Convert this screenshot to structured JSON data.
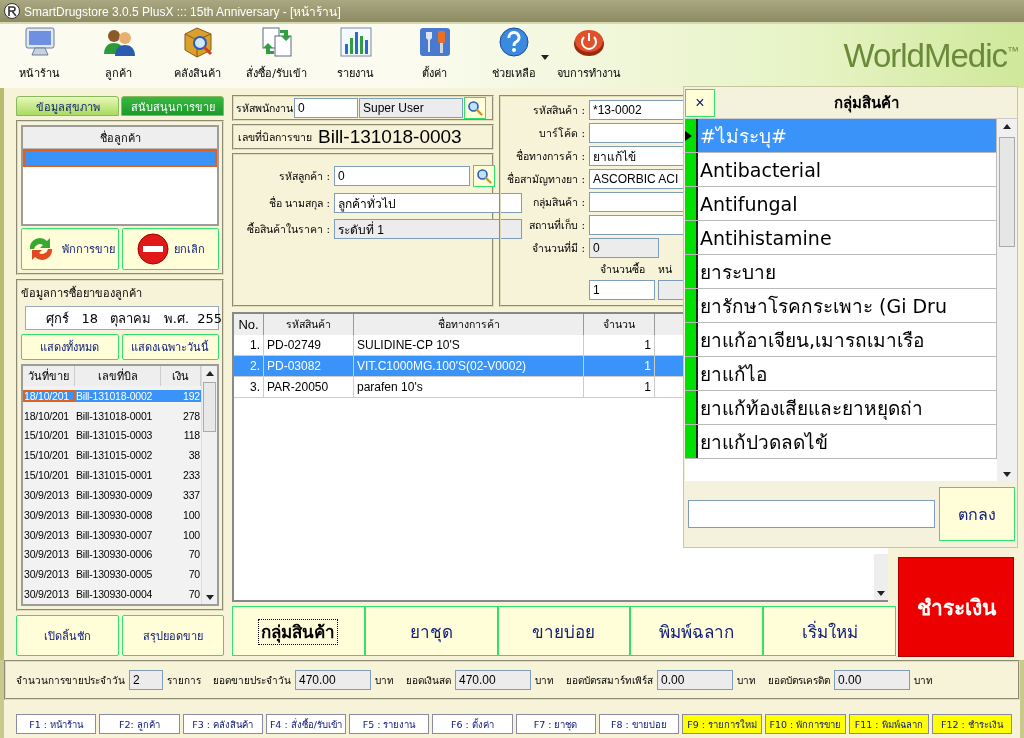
{
  "window": {
    "title": "SmartDrugstore 3.0.5 PlusX ::: 15th Anniversary - [หน้าร้าน]"
  },
  "toolbar": [
    {
      "label": "หน้าร้าน",
      "kind": "monitor",
      "has_menu": false
    },
    {
      "label": "ลูกค้า",
      "kind": "people",
      "has_menu": false
    },
    {
      "label": "คลังสินค้า",
      "kind": "stock",
      "has_menu": false
    },
    {
      "label": "สั่งซื้อ/รับเข้า",
      "kind": "exchange",
      "has_menu": false
    },
    {
      "label": "รายงาน",
      "kind": "chart",
      "has_menu": false
    },
    {
      "label": "ตั้งค่า",
      "kind": "tools",
      "has_menu": false
    },
    {
      "label": "ช่วยเหลือ",
      "kind": "help",
      "has_menu": true
    },
    {
      "label": "จบการทำงาน",
      "kind": "power",
      "has_menu": false
    }
  ],
  "logo": {
    "text": "WorldMedic",
    "mark": "™"
  },
  "left_tabs": [
    {
      "label": "ข้อมูลสุขภาพ",
      "selected": true
    },
    {
      "label": "สนับสนุนการขาย",
      "selected": false
    }
  ],
  "customer_list": {
    "header": "ชื่อลูกค้า",
    "rows": [
      {
        "selected": true
      }
    ]
  },
  "customer_buttons": [
    {
      "label": "พักการขาย",
      "kind": "hold"
    },
    {
      "label": "ยกเลิก",
      "kind": "cancel"
    }
  ],
  "history": {
    "title": "ข้อมูลการซื้อยาของลูกค้า",
    "date": {
      "day": "ศุกร์",
      "date": "18",
      "month": "ตุลาคม",
      "era": "พ.ศ.",
      "year": "255"
    },
    "buttons": [
      "แสดงทั้งหมด",
      "แสดงเฉพาะวันนี้"
    ],
    "columns": [
      "วันที่ขาย",
      "เลขที่บิล",
      "เงิน"
    ],
    "rows": [
      {
        "date": "18/10/201",
        "bill": "Bill-131018-0002",
        "amount": "192",
        "selected": true
      },
      {
        "date": "18/10/201",
        "bill": "Bill-131018-0001",
        "amount": "278",
        "selected": false
      },
      {
        "date": "15/10/201",
        "bill": "Bill-131015-0003",
        "amount": "118",
        "selected": false
      },
      {
        "date": "15/10/201",
        "bill": "Bill-131015-0002",
        "amount": "38",
        "selected": false
      },
      {
        "date": "15/10/201",
        "bill": "Bill-131015-0001",
        "amount": "233",
        "selected": false
      },
      {
        "date": "30/9/2013",
        "bill": "Bill-130930-0009",
        "amount": "337",
        "selected": false
      },
      {
        "date": "30/9/2013",
        "bill": "Bill-130930-0008",
        "amount": "100",
        "selected": false
      },
      {
        "date": "30/9/2013",
        "bill": "Bill-130930-0007",
        "amount": "100",
        "selected": false
      },
      {
        "date": "30/9/2013",
        "bill": "Bill-130930-0006",
        "amount": "70",
        "selected": false
      },
      {
        "date": "30/9/2013",
        "bill": "Bill-130930-0005",
        "amount": "70",
        "selected": false
      },
      {
        "date": "30/9/2013",
        "bill": "Bill-130930-0004",
        "amount": "70",
        "selected": false
      }
    ]
  },
  "left_bottom_buttons": [
    "เปิดลิ้นชัก",
    "สรุปยอดขาย"
  ],
  "employee": {
    "label": "รหัสพนักงาน",
    "code": "0",
    "name": "Super User"
  },
  "bill": {
    "label": "เลขที่บิลการขาย",
    "number": "Bill-131018-0003"
  },
  "customer": {
    "code_label": "รหัสลูกค้า :",
    "code": "0",
    "name_label": "ชื่อ นามสกุล :",
    "name": "ลูกค้าทั่วไป",
    "price_label": "ซื้อสินค้าในราคา :",
    "price": "ระดับที่ 1"
  },
  "product": {
    "fields": [
      {
        "label": "รหัสสินค้า :",
        "value": "*13-0002",
        "disabled": false
      },
      {
        "label": "บาร์โค้ด :",
        "disabled": false
      },
      {
        "label": "ชื่อทางการค้า :",
        "value": "ยาแก้ไข้",
        "disabled": false
      },
      {
        "label": "ชื่อสามัญทางยา :",
        "value": "ASCORBIC ACI",
        "disabled": false
      },
      {
        "label": "กลุ่มสินค้า :",
        "disabled": false
      },
      {
        "label": "สถานที่เก็บ :",
        "disabled": false
      },
      {
        "label": "จำนวนที่มี :",
        "value": "0",
        "disabled": true
      }
    ],
    "qty_label": "จำนวนซื้อ",
    "qty": "1",
    "unit_label": "หน่"
  },
  "items": {
    "columns": [
      "No.",
      "รหัสสินค้า",
      "ชื่อทางการค้า",
      "จำนวน"
    ],
    "rows": [
      {
        "no": "1.",
        "code": "PD-02749",
        "name": "SULIDINE-CP 10'S",
        "qty": "1",
        "selected": false
      },
      {
        "no": "2.",
        "code": "PD-03082",
        "name": "VIT.C1000MG.100'S(02-V0002)",
        "qty": "1",
        "selected": true
      },
      {
        "no": "3.",
        "code": "PAR-20050",
        "name": "parafen 10's",
        "qty": "1",
        "selected": false
      }
    ]
  },
  "action_buttons": [
    {
      "label": "กลุ่มสินค้า",
      "focused": true
    },
    {
      "label": "ยาชุด",
      "focused": false
    },
    {
      "label": "ขายบ่อย",
      "focused": false
    },
    {
      "label": "พิมพ์ฉลาก",
      "focused": false
    },
    {
      "label": "เริ่มใหม่",
      "focused": false
    }
  ],
  "pay_button": "ชำระเงิน",
  "popup": {
    "close": "×",
    "title": "กลุ่มสินค้า",
    "items": [
      {
        "label": "#ไม่ระบุ#",
        "selected": true
      },
      {
        "label": "Antibacterial",
        "selected": false
      },
      {
        "label": "Antifungal",
        "selected": false
      },
      {
        "label": "Antihistamine",
        "selected": false
      },
      {
        "label": "ยาระบาย",
        "selected": false
      },
      {
        "label": "ยารักษาโรคกระเพาะ (Gi Dru",
        "selected": false
      },
      {
        "label": "ยาแก้อาเจียน,เมารถเมาเรือ",
        "selected": false
      },
      {
        "label": "ยาแก้ไอ",
        "selected": false
      },
      {
        "label": "ยาแก้ท้องเสียและยาหยุดถ่า",
        "selected": false
      },
      {
        "label": "ยาแก้ปวดลดไข้",
        "selected": false
      }
    ],
    "ok": "ตกลง"
  },
  "summary": [
    {
      "label": "จำนวนการขายประจำวัน",
      "value": "2",
      "unit": "รายการ"
    },
    {
      "label": "ยอดขายประจำวัน",
      "value": "470.00",
      "unit": "บาท"
    },
    {
      "label": "ยอดเงินสด",
      "value": "470.00",
      "unit": "บาท"
    },
    {
      "label": "ยอดบัตรสมาร์ทเพิร์ส",
      "value": "0.00",
      "unit": "บาท"
    },
    {
      "label": "ยอดบัตรเครดิต",
      "value": "0.00",
      "unit": "บาท"
    }
  ],
  "function_keys": [
    {
      "label": "F1 : หน้าร้าน",
      "highlight": false
    },
    {
      "label": "F2: ลูกค้า",
      "highlight": false
    },
    {
      "label": "F3 : คลังสินค้า",
      "highlight": false
    },
    {
      "label": "F4 : สั่งซื้อ/รับเข้า",
      "highlight": false
    },
    {
      "label": "F5 : รายงาน",
      "highlight": false
    },
    {
      "label": "F6 : ตั้งค่า",
      "highlight": false
    },
    {
      "label": "F7 : ยาชุด",
      "highlight": false
    },
    {
      "label": "F8 : ขายบ่อย",
      "highlight": false
    },
    {
      "label": "F9 : รายการใหม่",
      "highlight": true
    },
    {
      "label": "F10 : พักการขาย",
      "highlight": true
    },
    {
      "label": "F11 : พิมพ์ฉลาก",
      "highlight": true
    },
    {
      "label": "F12 : ชำระเงิน",
      "highlight": true
    }
  ]
}
